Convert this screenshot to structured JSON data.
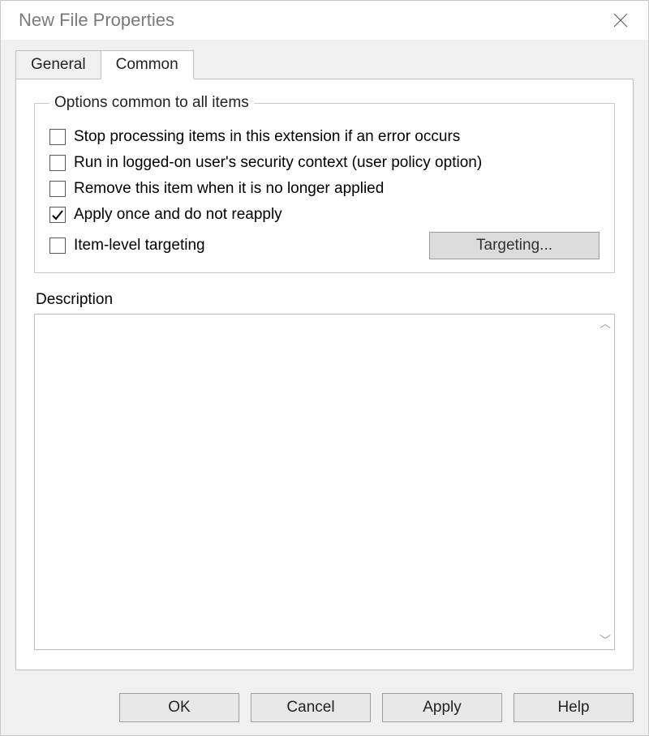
{
  "window": {
    "title": "New File Properties"
  },
  "tabs": {
    "general": "General",
    "common": "Common",
    "active": "common"
  },
  "groupbox": {
    "legend": "Options common to all items",
    "options": {
      "stop": {
        "label": "Stop processing items in this extension if an error occurs",
        "checked": false
      },
      "run": {
        "label": "Run in logged-on user's security context (user policy option)",
        "checked": false
      },
      "remove": {
        "label": "Remove this item when it is no longer applied",
        "checked": false
      },
      "apply_once": {
        "label": "Apply once and do not reapply",
        "checked": true
      },
      "targeting_cb": {
        "label": "Item-level targeting",
        "checked": false
      }
    },
    "targeting_button": "Targeting..."
  },
  "description": {
    "label": "Description",
    "value": ""
  },
  "buttons": {
    "ok": "OK",
    "cancel": "Cancel",
    "apply": "Apply",
    "help": "Help"
  }
}
